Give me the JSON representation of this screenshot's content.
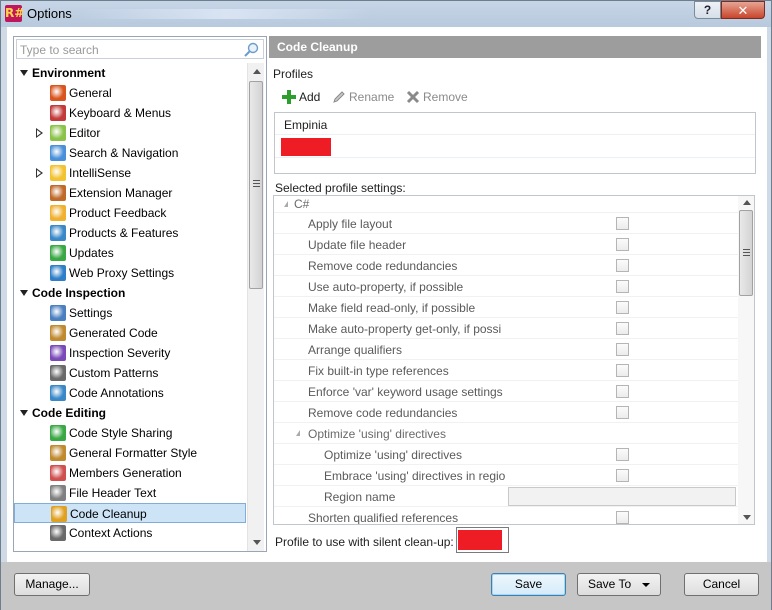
{
  "window": {
    "title": "Options",
    "app_icon_text": "R#",
    "help_label": "?",
    "close_label": "✕"
  },
  "search": {
    "placeholder": "Type to search"
  },
  "tree": {
    "groups": [
      {
        "label": "Environment",
        "items": [
          {
            "label": "General",
            "icon": "general-icon",
            "color": "#d9541e"
          },
          {
            "label": "Keyboard & Menus",
            "icon": "keyboard-icon",
            "color": "#c33a3a"
          },
          {
            "label": "Editor",
            "icon": "editor-icon",
            "color": "#8bc34a",
            "expandable": true
          },
          {
            "label": "Search & Navigation",
            "icon": "search-nav-icon",
            "color": "#4a90d9"
          },
          {
            "label": "IntelliSense",
            "icon": "bulb-icon",
            "color": "#f2c230",
            "expandable": true
          },
          {
            "label": "Extension Manager",
            "icon": "extension-icon",
            "color": "#c06a2a"
          },
          {
            "label": "Product Feedback",
            "icon": "envelope-icon",
            "color": "#f0b030"
          },
          {
            "label": "Products & Features",
            "icon": "products-icon",
            "color": "#3a88c8"
          },
          {
            "label": "Updates",
            "icon": "updates-icon",
            "color": "#3aa845"
          },
          {
            "label": "Web Proxy Settings",
            "icon": "globe-icon",
            "color": "#2f7ec8"
          }
        ]
      },
      {
        "label": "Code Inspection",
        "items": [
          {
            "label": "Settings",
            "icon": "settings-list-icon",
            "color": "#4a7fc0"
          },
          {
            "label": "Generated Code",
            "icon": "generated-code-icon",
            "color": "#c08a30"
          },
          {
            "label": "Inspection Severity",
            "icon": "severity-icon",
            "color": "#7a4ab8"
          },
          {
            "label": "Custom Patterns",
            "icon": "patterns-icon",
            "color": "#6a6a6a"
          },
          {
            "label": "Code Annotations",
            "icon": "annotations-icon",
            "color": "#3a88c8"
          }
        ]
      },
      {
        "label": "Code Editing",
        "items": [
          {
            "label": "Code Style Sharing",
            "icon": "style-sharing-icon",
            "color": "#3aa845"
          },
          {
            "label": "General Formatter Style",
            "icon": "formatter-icon",
            "color": "#c08a30"
          },
          {
            "label": "Members Generation",
            "icon": "members-icon",
            "color": "#d05050"
          },
          {
            "label": "File Header Text",
            "icon": "file-header-icon",
            "color": "#808080"
          },
          {
            "label": "Code Cleanup",
            "icon": "broom-icon",
            "color": "#e0a020",
            "selected": true
          },
          {
            "label": "Context Actions",
            "icon": "hammer-icon",
            "color": "#6a6a6a"
          }
        ]
      }
    ]
  },
  "right": {
    "header": "Code Cleanup",
    "profiles_label": "Profiles",
    "toolbar": {
      "add": "Add",
      "rename": "Rename",
      "remove": "Remove"
    },
    "profiles": [
      "Empinia"
    ],
    "selected_label": "Selected profile settings:",
    "settings": {
      "language": "C#",
      "rows": [
        {
          "label": "Apply file layout",
          "indent": 1
        },
        {
          "label": "Update file header",
          "indent": 1
        },
        {
          "label": "Remove code redundancies",
          "indent": 1
        },
        {
          "label": "Use auto-property, if possible",
          "indent": 1
        },
        {
          "label": "Make field read-only, if possible",
          "indent": 1
        },
        {
          "label": "Make auto-property get-only, if possi",
          "indent": 1
        },
        {
          "label": "Arrange qualifiers",
          "indent": 1
        },
        {
          "label": "Fix built-in type references",
          "indent": 1
        },
        {
          "label": "Enforce 'var' keyword usage settings",
          "indent": 1
        },
        {
          "label": "Remove code redundancies",
          "indent": 1
        },
        {
          "label": "Optimize 'using' directives",
          "indent": 1,
          "group": true
        },
        {
          "label": "Optimize 'using' directives",
          "indent": 2
        },
        {
          "label": "Embrace 'using' directives in regio",
          "indent": 2
        },
        {
          "label": "Region name",
          "indent": 2,
          "textbox": true
        },
        {
          "label": "Shorten qualified references",
          "indent": 1
        }
      ]
    },
    "silent_label": "Profile to use with silent clean-up:"
  },
  "buttons": {
    "manage": "Manage...",
    "save": "Save",
    "save_to": "Save To",
    "cancel": "Cancel"
  }
}
